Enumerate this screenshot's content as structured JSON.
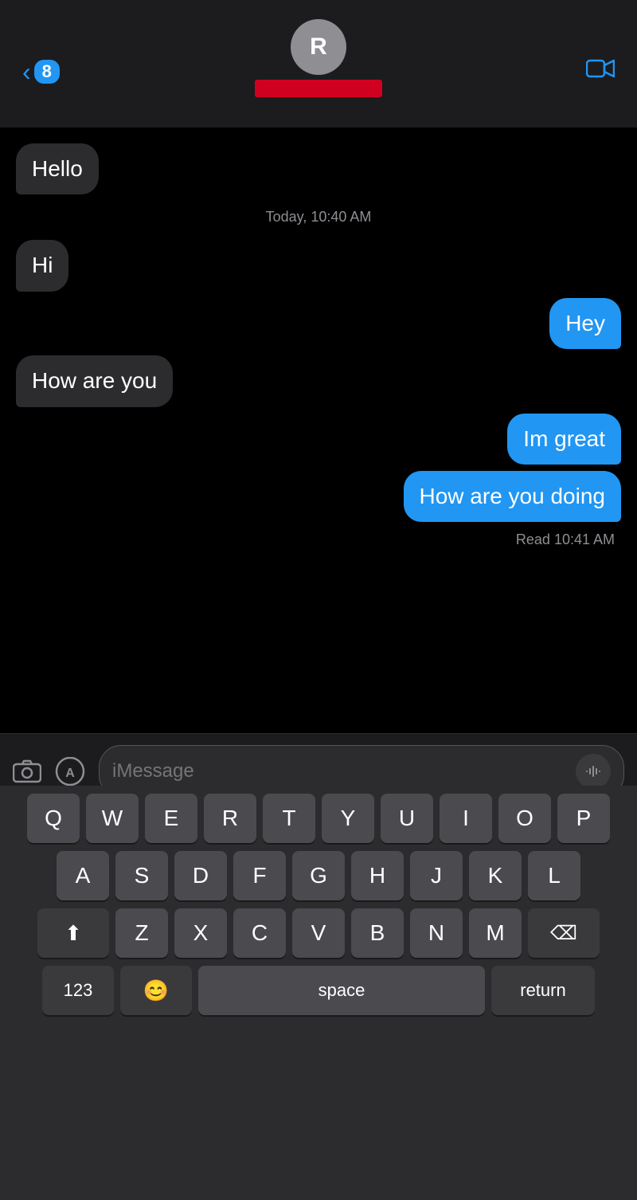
{
  "header": {
    "back_badge": "8",
    "contact_initial": "R",
    "timestamp": "Today, 10:40 AM",
    "read_receipt": "Read 10:41 AM"
  },
  "messages": [
    {
      "id": 1,
      "type": "incoming",
      "text": "Hello"
    },
    {
      "id": 2,
      "type": "incoming",
      "text": "Hi"
    },
    {
      "id": 3,
      "type": "outgoing",
      "text": "Hey"
    },
    {
      "id": 4,
      "type": "incoming",
      "text": "How are you"
    },
    {
      "id": 5,
      "type": "outgoing",
      "text": "Im great"
    },
    {
      "id": 6,
      "type": "outgoing",
      "text": "How are you doing"
    }
  ],
  "input": {
    "placeholder": "iMessage"
  },
  "keyboard": {
    "rows": [
      [
        "Q",
        "W",
        "E",
        "R",
        "T",
        "Y",
        "U",
        "I",
        "O",
        "P"
      ],
      [
        "A",
        "S",
        "D",
        "F",
        "G",
        "H",
        "J",
        "K",
        "L"
      ],
      [
        "Z",
        "X",
        "C",
        "V",
        "B",
        "N",
        "M"
      ],
      [
        "123",
        "😊",
        "space",
        "return"
      ]
    ],
    "space_label": "space",
    "return_label": "return",
    "num_label": "123"
  }
}
